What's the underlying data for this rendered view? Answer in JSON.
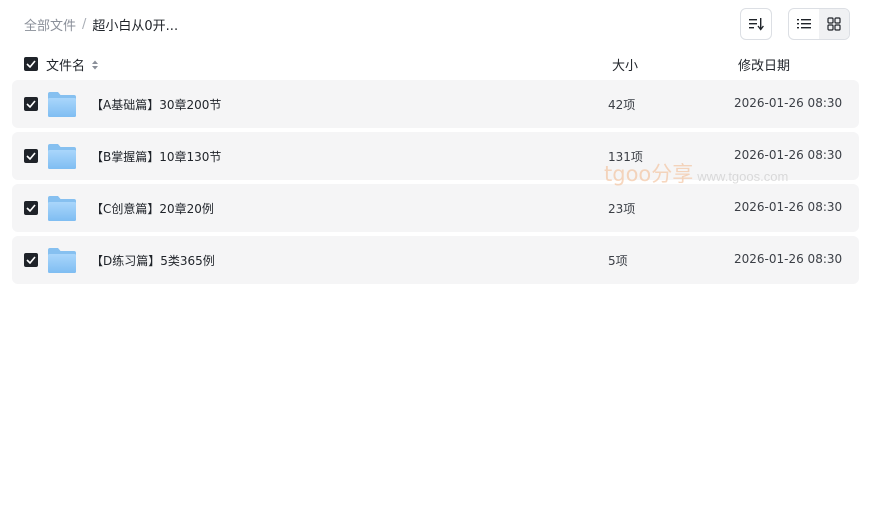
{
  "breadcrumb": {
    "root": "全部文件",
    "separator": "/",
    "current": "超小白从0开..."
  },
  "toolbar": {
    "sort_icon": "sort-list-icon",
    "list_view_icon": "list-view-icon",
    "grid_view_icon": "grid-view-icon"
  },
  "columns": {
    "name": "文件名",
    "size": "大小",
    "date": "修改日期"
  },
  "files": [
    {
      "name": "【A基础篇】30章200节",
      "size": "42项",
      "date": "2026-01-26 08:30"
    },
    {
      "name": "【B掌握篇】10章130节",
      "size": "131项",
      "date": "2026-01-26 08:30"
    },
    {
      "name": "【C创意篇】20章20例",
      "size": "23项",
      "date": "2026-01-26 08:30"
    },
    {
      "name": "【D练习篇】5类365例",
      "size": "5项",
      "date": "2026-01-26 08:30"
    }
  ],
  "watermark": {
    "brand": "tgoo分享",
    "site": "www.tgoos.com"
  },
  "colors": {
    "folder": "#8cc4f5",
    "row_bg": "#f5f5f6",
    "checkbox": "#1f2329"
  }
}
